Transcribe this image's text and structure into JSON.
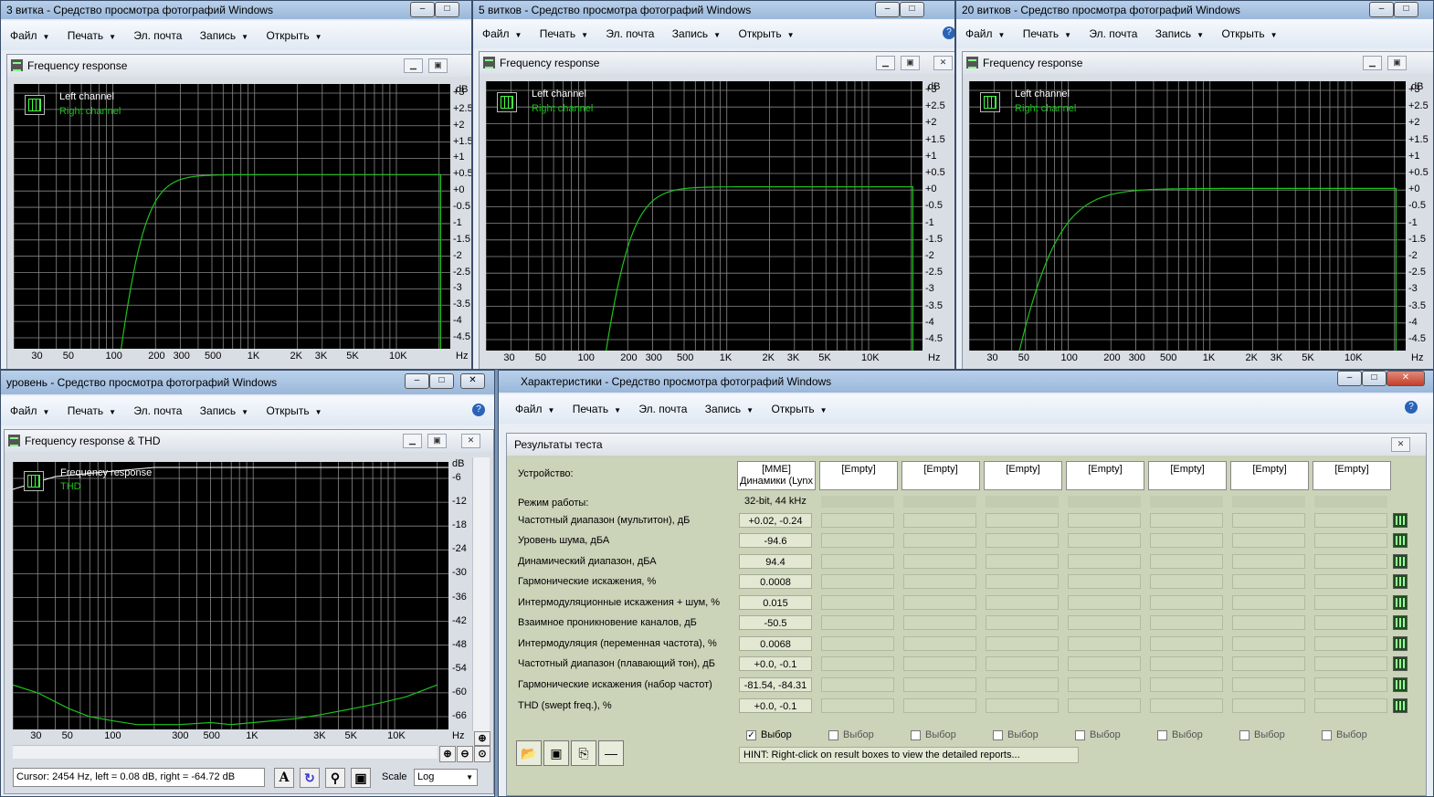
{
  "menu": {
    "file": "Файл",
    "print": "Печать",
    "email": "Эл. почта",
    "record": "Запись",
    "open": "Открыть"
  },
  "common": {
    "left_channel": "Left channel",
    "right_channel": "Right channel",
    "hz": "Hz",
    "db": "dB"
  },
  "win1": {
    "title": "3 витка - Средство просмотра фотографий Windows",
    "frame_title": "Frequency response"
  },
  "win2": {
    "title": "5 витков - Средство просмотра фотографий Windows",
    "frame_title": "Frequency response"
  },
  "win3": {
    "title": "20 витков - Средство просмотра фотографий Windows",
    "frame_title": "Frequency response"
  },
  "win4": {
    "title": "уровень - Средство просмотра фотографий Windows",
    "frame_title": "Frequency response & THD",
    "legend1": "Frequency response",
    "legend2": "THD",
    "cursor": "Cursor:  2454 Hz,  left = 0.08 dB,  right = -64.72 dB",
    "scale_label": "Scale",
    "scale_value": "Log"
  },
  "win5": {
    "title": "Характеристики - Средство просмотра фотографий Windows",
    "panel_title": "Результаты теста",
    "device_label": "Устройство:",
    "device_value": "[MME] Динамики (Lynx",
    "empty": "[Empty]",
    "mode_label": "Режим работы:",
    "mode_value": "32-bit, 44 kHz",
    "rows": [
      {
        "label": "Частотный диапазон (мультитон), дБ",
        "value": "+0.02, -0.24"
      },
      {
        "label": "Уровень шума, дБА",
        "value": "-94.6"
      },
      {
        "label": "Динамический диапазон, дБА",
        "value": "94.4"
      },
      {
        "label": "Гармонические искажения, %",
        "value": "0.0008"
      },
      {
        "label": "Интермодуляционные искажения + шум, %",
        "value": "0.015"
      },
      {
        "label": "Взаимное проникновение каналов, дБ",
        "value": "-50.5"
      },
      {
        "label": "Интермодуляция (переменная частота), %",
        "value": "0.0068"
      },
      {
        "label": "Частотный диапазон (плавающий тон), дБ",
        "value": "+0.0, -0.1"
      },
      {
        "label": "Гармонические искажения (набор частот)",
        "value": "-81.54, -84.31"
      },
      {
        "label": "THD (swept freq.), %",
        "value": "+0.0, -0.1"
      }
    ],
    "select_label": "Выбор",
    "hint": "HINT: Right-click on result boxes to view the detailed reports..."
  },
  "fr_axes": {
    "y_ticks": [
      "+3",
      "+2.5",
      "+2",
      "+1.5",
      "+1",
      "+0.5",
      "+0",
      "-0.5",
      "-1",
      "-1.5",
      "-2",
      "-2.5",
      "-3",
      "-3.5",
      "-4",
      "-4.5"
    ],
    "x_ticks": [
      "30",
      "50",
      "100",
      "200",
      "300",
      "500",
      "1K",
      "2K",
      "3K",
      "5K",
      "10K"
    ]
  },
  "thd_axes": {
    "y_ticks": [
      "-6",
      "-12",
      "-18",
      "-24",
      "-30",
      "-36",
      "-42",
      "-48",
      "-54",
      "-60",
      "-66"
    ],
    "x_ticks": [
      "30",
      "50",
      "100",
      "300",
      "500",
      "1K",
      "3K",
      "5K",
      "10K"
    ]
  },
  "colors": {
    "trace": "#1dc21d",
    "grid": "#8a8a8a",
    "plot_bg": "#000000"
  }
}
